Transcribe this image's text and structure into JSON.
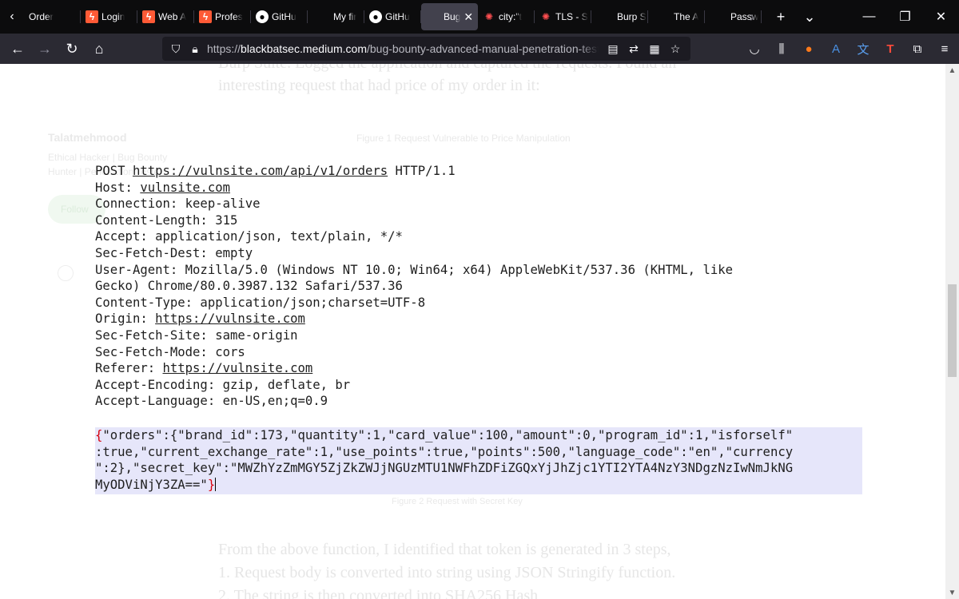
{
  "tabs": [
    {
      "label": "Order",
      "favicon": "chevron-left"
    },
    {
      "label": "Login",
      "favicon": "red-bolt"
    },
    {
      "label": "Web A",
      "favicon": "red-bolt"
    },
    {
      "label": "Profes",
      "favicon": "red-bolt"
    },
    {
      "label": "GitHu",
      "favicon": "github"
    },
    {
      "label": "My fir",
      "favicon": "none"
    },
    {
      "label": "GitHu",
      "favicon": "github"
    },
    {
      "label": "Bug",
      "favicon": "none",
      "active": true
    },
    {
      "label": "city:\"t",
      "favicon": "burp"
    },
    {
      "label": "TLS - S",
      "favicon": "burp"
    },
    {
      "label": "Burp S",
      "favicon": "none"
    },
    {
      "label": "The A",
      "favicon": "none"
    },
    {
      "label": "Passw",
      "favicon": "none"
    }
  ],
  "url": {
    "prefix": "https://",
    "host": "blackbatsec.medium.com",
    "path": "/bug-bounty-advanced-manual-penetration-testing-l"
  },
  "background_text": {
    "top_line1": "Burp Suite. Logged the application and captured the requests. Found an",
    "top_line2": "interesting request that had price of my order in it:",
    "author": "Talatmehmood",
    "author_bio1": "Ethical Hacker | Bug Bounty",
    "author_bio2": "Hunter | Penetration Tester",
    "follow": "Follow",
    "figure_caption": "Figure 1 Request Vulnerable to Price Manipulation",
    "figure_caption2": "Figure 2 Request with Secret Key",
    "bottom_line1": "From the above function, I identified that token is generated in 3 steps,",
    "bottom_line2": "1. Request body is converted into string using JSON Stringify function.",
    "bottom_line3": "2. The string is then converted into SHA256 Hash"
  },
  "request": {
    "method": "POST",
    "url": "https://vulnsite.com/api/v1/orders",
    "protocol": "HTTP/1.1",
    "host_label": "Host: ",
    "host": "vulnsite.com",
    "connection": "Connection: keep-alive",
    "content_length": "Content-Length: 315",
    "accept": "Accept: application/json, text/plain, */*",
    "sec_fetch_dest": "Sec-Fetch-Dest: empty",
    "user_agent_1": "User-Agent: Mozilla/5.0 (Windows NT 10.0; Win64; x64) AppleWebKit/537.36 (KHTML, like",
    "user_agent_2": "Gecko) Chrome/80.0.3987.132 Safari/537.36",
    "content_type": "Content-Type: application/json;charset=UTF-8",
    "origin_label": "Origin: ",
    "origin": "https://vulnsite.com",
    "sec_fetch_site": "Sec-Fetch-Site: same-origin",
    "sec_fetch_mode": "Sec-Fetch-Mode: cors",
    "referer_label": "Referer: ",
    "referer": "https://vulnsite.com",
    "accept_encoding": "Accept-Encoding: gzip, deflate, br",
    "accept_language": "Accept-Language: en-US,en;q=0.9"
  },
  "body": {
    "open_brace": "{",
    "line1": "\"orders\":{\"brand_id\":173,\"quantity\":1,\"card_value\":100,\"amount\":0,\"program_id\":1,\"isforself\"",
    "line2": ":true,\"current_exchange_rate\":1,\"use_points\":true,\"points\":500,\"language_code\":\"en\",\"currency",
    "line3": "\":2},\"secret_key\":\"MWZhYzZmMGY5ZjZkZWJjNGUzMTU1NWFhZDFiZGQxYjJhZjc1YTI2YTA4NzY3NDgzNzIwNmJkNG",
    "line4": "MyODViNjY3ZA==\"",
    "close_brace": "}"
  }
}
